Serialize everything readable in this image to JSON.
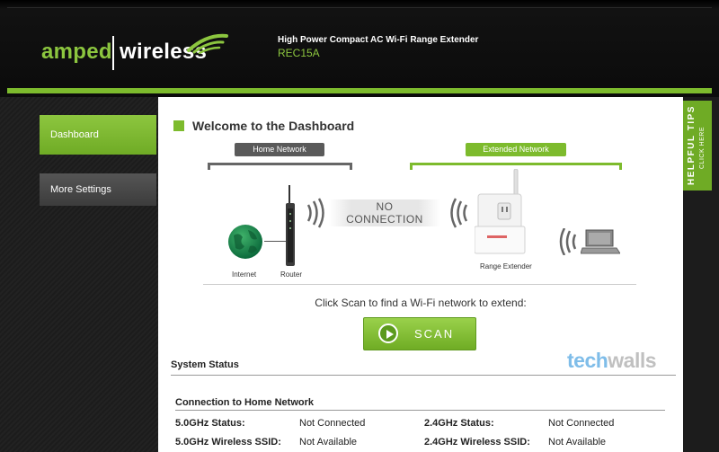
{
  "header": {
    "logo_left": "amped",
    "logo_right": "wireless",
    "product_title": "High Power Compact AC Wi-Fi Range Extender",
    "model": "REC15A"
  },
  "sidebar": {
    "items": [
      {
        "label": "Dashboard",
        "active": true
      },
      {
        "label": "More Settings",
        "active": false
      }
    ]
  },
  "helpful_tips": {
    "title": "HELPFUL TIPS",
    "subtitle": "CLICK HERE"
  },
  "welcome_title": "Welcome to the Dashboard",
  "diagram": {
    "home_network_label": "Home Network",
    "extended_network_label": "Extended Network",
    "no_connection_line1": "NO",
    "no_connection_line2": "CONNECTION",
    "internet_label": "Internet",
    "router_label": "Router",
    "extender_label": "Range Extender"
  },
  "scan": {
    "instruction": "Click Scan to find a Wi-Fi network to extend:",
    "button_label": "SCAN"
  },
  "system_status_title": "System Status",
  "watermark": {
    "part1": "tech",
    "part2": "walls"
  },
  "connection": {
    "title": "Connection to Home Network",
    "rows": [
      {
        "label": "5.0GHz Status:",
        "value": "Not Connected",
        "label2": "2.4GHz Status:",
        "value2": "Not Connected"
      },
      {
        "label": "5.0GHz Wireless SSID:",
        "value": "Not Available",
        "label2": "2.4GHz Wireless SSID:",
        "value2": "Not Available"
      }
    ]
  },
  "colors": {
    "brand_green": "#7dbb2d",
    "header_bg": "#0c0c0c",
    "nav_inactive": "#444444"
  }
}
